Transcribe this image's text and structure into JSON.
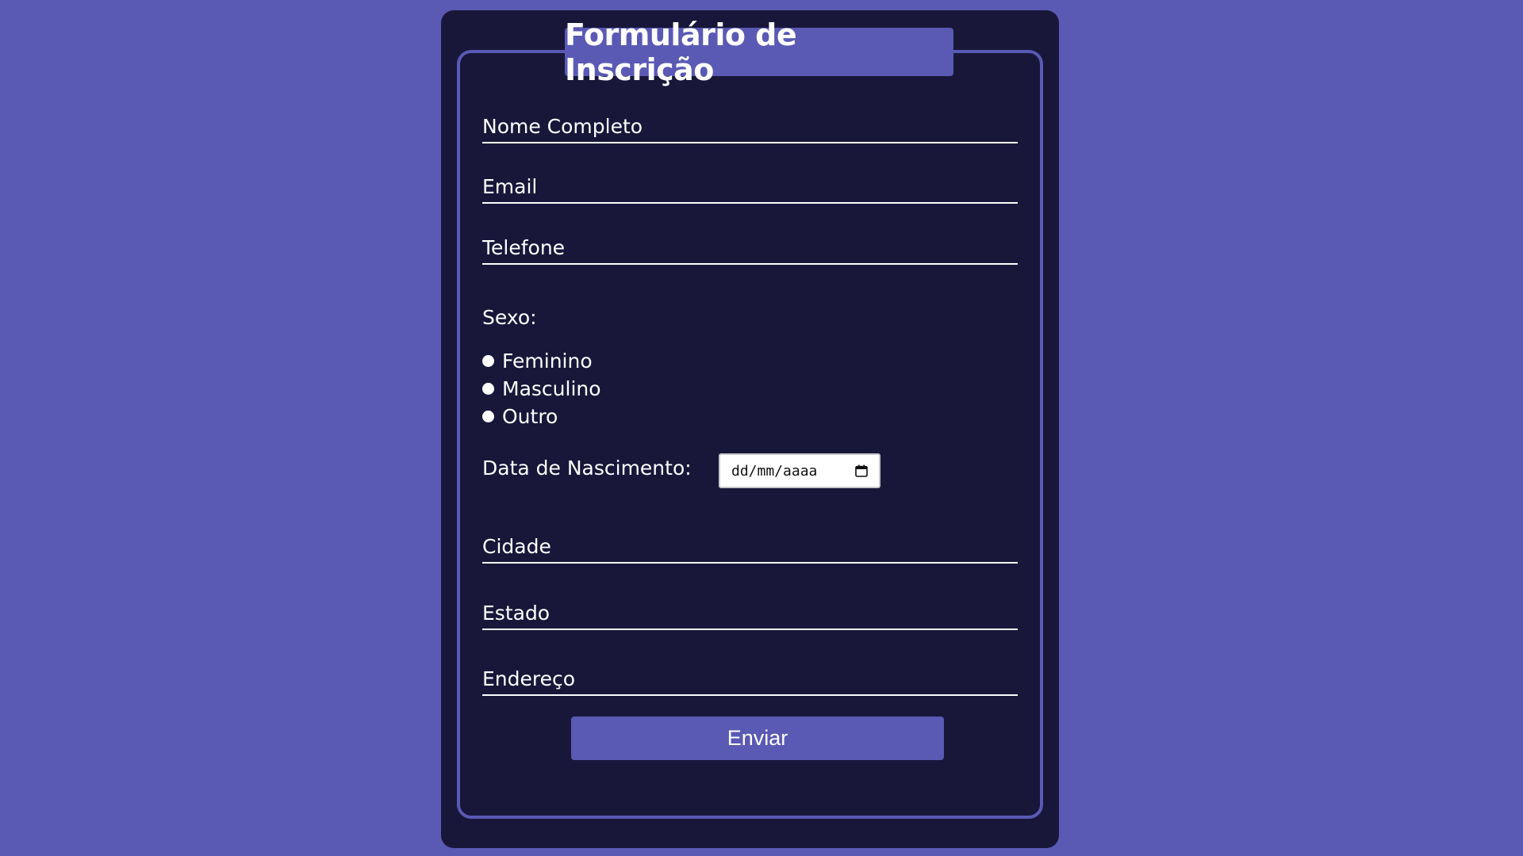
{
  "form": {
    "title": "Formulário de Inscrição",
    "fields": {
      "nome": {
        "placeholder": "Nome Completo",
        "value": ""
      },
      "email": {
        "placeholder": "Email",
        "value": ""
      },
      "telefone": {
        "placeholder": "Telefone",
        "value": ""
      },
      "cidade": {
        "placeholder": "Cidade",
        "value": ""
      },
      "estado": {
        "placeholder": "Estado",
        "value": ""
      },
      "endereco": {
        "placeholder": "Endereço",
        "value": ""
      }
    },
    "sexo": {
      "label": "Sexo:",
      "options": [
        {
          "label": "Feminino"
        },
        {
          "label": "Masculino"
        },
        {
          "label": "Outro"
        }
      ]
    },
    "nascimento": {
      "label": "Data de Nascimento:",
      "value": "dd/mm/aaaa",
      "icon": "calendar-icon"
    },
    "submit_label": "Enviar"
  },
  "colors": {
    "page_background": "#5a59b4",
    "card_background": "#18173a",
    "accent": "#5a59b4",
    "text": "#ffffff"
  }
}
